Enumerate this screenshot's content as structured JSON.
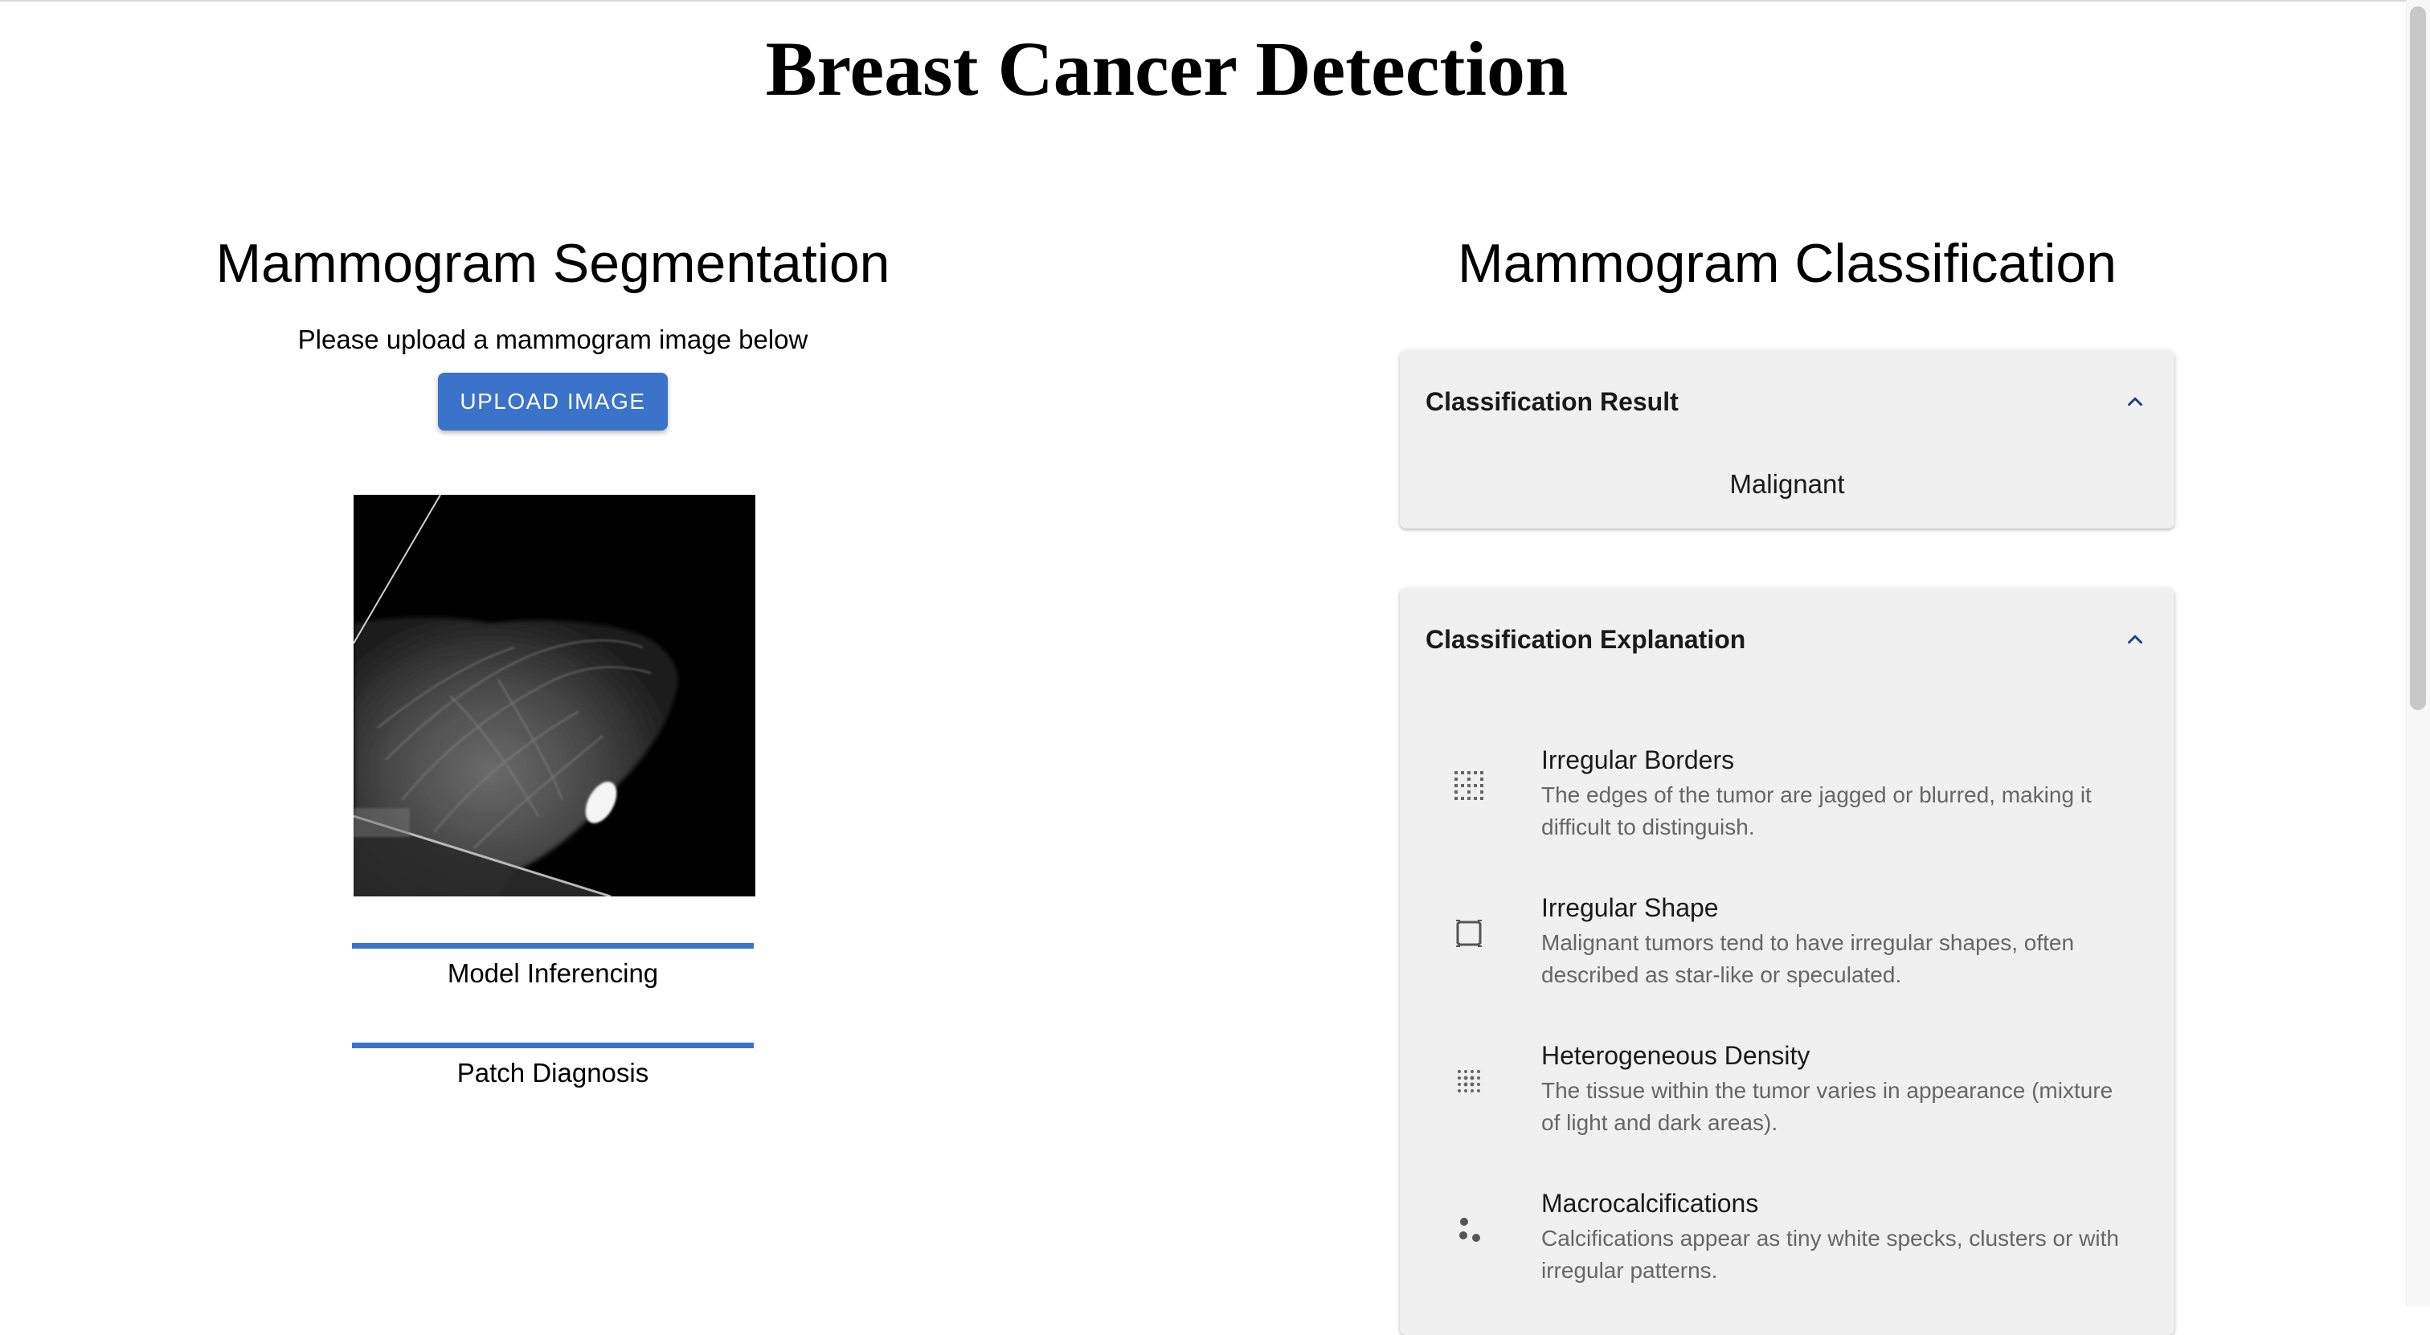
{
  "header": {
    "title": "Breast Cancer Detection"
  },
  "segmentation": {
    "title": "Mammogram Segmentation",
    "upload_prompt": "Please upload a mammogram image below",
    "upload_button": "UPLOAD IMAGE",
    "progress": [
      {
        "label": "Model Inferencing",
        "value": 1.0
      },
      {
        "label": "Patch Diagnosis",
        "value": 1.0
      }
    ]
  },
  "classification": {
    "title": "Mammogram Classification",
    "result_panel": {
      "header": "Classification Result",
      "value": "Malignant",
      "expanded": true
    },
    "explanation_panel": {
      "header": "Classification Explanation",
      "expanded": true,
      "items": [
        {
          "icon": "grid-dots-icon",
          "name": "Irregular Borders",
          "description": "The edges of the tumor are jagged or blurred, making it difficult to distinguish."
        },
        {
          "icon": "irregular-shape-icon",
          "name": "Irregular Shape",
          "description": "Malignant tumors tend to have irregular shapes, often described as star-like or speculated."
        },
        {
          "icon": "density-dots-icon",
          "name": "Heterogeneous Density",
          "description": "The tissue within the tumor varies in appearance (mixture of light and dark areas)."
        },
        {
          "icon": "scatter-dots-icon",
          "name": "Macrocalcifications",
          "description": "Calcifications appear as tiny white specks, clusters or with irregular patterns."
        }
      ]
    }
  },
  "colors": {
    "accent": "#3a73c9",
    "panel_bg": "#f0f0f0",
    "chevron": "#1f3f8f",
    "muted_text": "#666666"
  }
}
